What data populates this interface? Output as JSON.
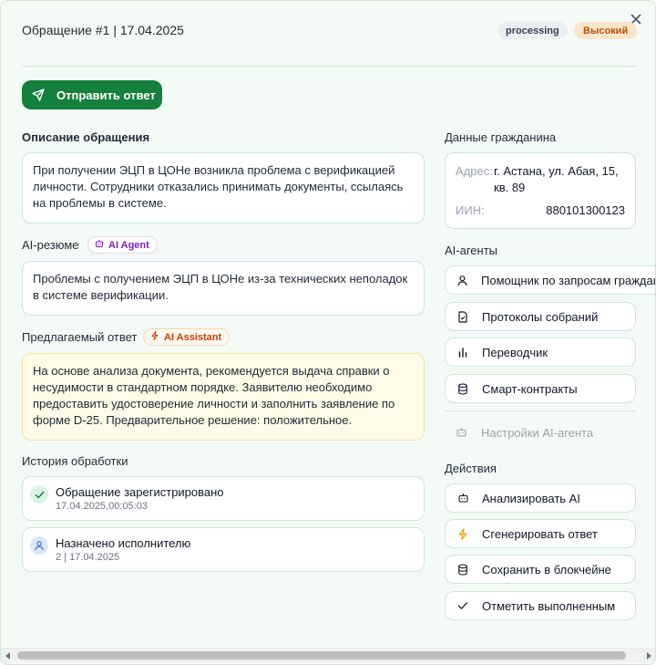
{
  "header": {
    "title": "Обращение #1 | 17.04.2025",
    "status_badge": "processing",
    "priority_badge": "Высокий",
    "close_icon": "close-icon"
  },
  "actions": {
    "send_reply": "Отправить ответ"
  },
  "description": {
    "label": "Описание обращения",
    "text": "При получении ЭЦП в ЦОНе возникла проблема с верификацией личности. Сотрудники отказались принимать документы, ссылаясь на проблемы в системе."
  },
  "ai_summary": {
    "label": "AI-резюме",
    "badge": "AI Agent",
    "text": "Проблемы с получением ЭЦП в ЦОНе из-за технических неполадок в системе верификации."
  },
  "suggested_reply": {
    "label": "Предлагаемый ответ",
    "badge": "AI Assistant",
    "text": "На основе анализа документа, рекомендуется выдача справки о несудимости в стандартном порядке. Заявителю необходимо предоставить удостоверение личности и заполнить заявление по форме D-25. Предварительное решение: положительное."
  },
  "history": {
    "label": "История обработки",
    "items": [
      {
        "title": "Обращение зарегистрировано",
        "subtitle": "17.04.2025,00:05:03",
        "icon": "check-icon"
      },
      {
        "title": "Назначено исполнителю",
        "subtitle": "2 | 17.04.2025",
        "icon": "user-icon"
      }
    ]
  },
  "citizen": {
    "label": "Данные гражданина",
    "address_label": "Адрес:",
    "address_line1": "г. Астана, ул. Абая, 15,",
    "address_line2": "кв. 89",
    "iin_label": "ИИН:",
    "iin_value": "880101300123"
  },
  "ai_agents": {
    "label": "AI-агенты",
    "items": [
      {
        "label": "Помощник по запросам граждан",
        "icon": "user-icon"
      },
      {
        "label": "Протоколы собраний",
        "icon": "document-icon"
      },
      {
        "label": "Переводчик",
        "icon": "bar-chart-icon"
      },
      {
        "label": "Смарт-контракты",
        "icon": "database-icon"
      }
    ],
    "settings_label": "Настройки AI-агента"
  },
  "actions_panel": {
    "label": "Действия",
    "items": [
      {
        "label": "Анализировать AI",
        "icon": "robot-icon"
      },
      {
        "label": "Сгенерировать ответ",
        "icon": "lightning-icon"
      },
      {
        "label": "Сохранить в блокчейне",
        "icon": "database-icon"
      },
      {
        "label": "Отметить выполненным",
        "icon": "check-icon"
      }
    ]
  },
  "colors": {
    "accent": "#15803d",
    "background": "#f4fbf6",
    "border": "#cfe6d6",
    "priority_bg": "#fde5cc",
    "priority_text": "#b45309",
    "ai_agent_text": "#7e22ce",
    "ai_assistant_text": "#c2410c",
    "suggested_bg": "#fefbe8"
  }
}
